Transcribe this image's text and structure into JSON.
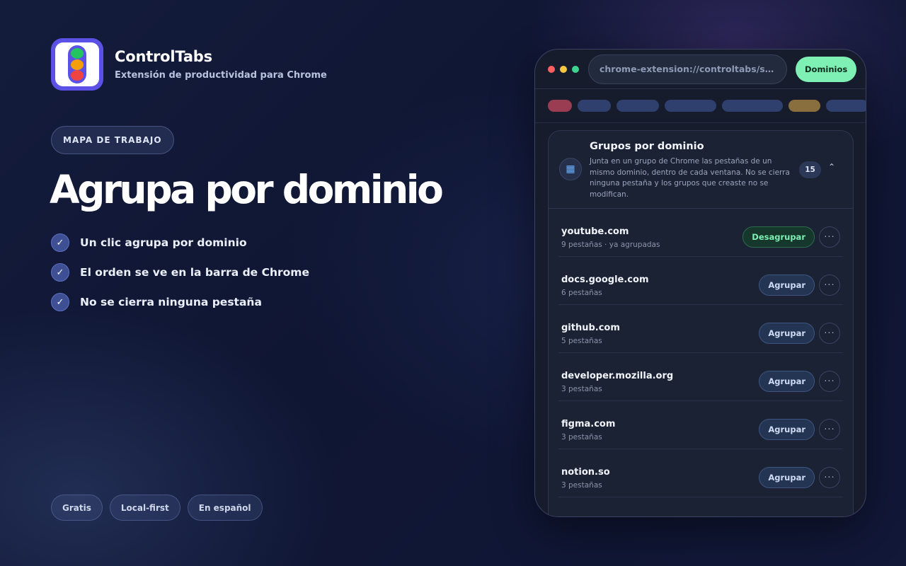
{
  "brand": {
    "name": "ControlTabs",
    "tagline": "Extensión de productividad para Chrome"
  },
  "eyebrow": "MAPA DE TRABAJO",
  "headline": "Agrupa por dominio",
  "features": [
    "Un clic agrupa por dominio",
    "El orden se ve en la barra de Chrome",
    "No se cierra ninguna pestaña"
  ],
  "check_glyph": "✓",
  "badges": [
    "Gratis",
    "Local-first",
    "En español"
  ],
  "browser": {
    "url": "chrome-extension://controltabs/sidepanel",
    "action_label": "Dominios"
  },
  "tab_colors": [
    "#9b3d52",
    "#2f3f6e",
    "#2f3f6e",
    "#2f3f6e",
    "#2f3f6e",
    "#8a6f3e",
    "#2f3f6e"
  ],
  "panel": {
    "title": "Grupos por dominio",
    "description": "Junta en un grupo de Chrome las pestañas de un mismo dominio, dentro de cada ventana. No se cierra ninguna pestaña y los grupos que creaste no se modifican.",
    "count": "15",
    "icon": "grid-icon",
    "caret": "chevron-up-icon"
  },
  "rows": [
    {
      "domain": "youtube.com",
      "meta": "9 pestañas · ya agrupadas",
      "action": "Desagrupar",
      "state": "grouped"
    },
    {
      "domain": "docs.google.com",
      "meta": "6 pestañas",
      "action": "Agrupar",
      "state": "ungrouped"
    },
    {
      "domain": "github.com",
      "meta": "5 pestañas",
      "action": "Agrupar",
      "state": "ungrouped"
    },
    {
      "domain": "developer.mozilla.org",
      "meta": "3 pestañas",
      "action": "Agrupar",
      "state": "ungrouped"
    },
    {
      "domain": "figma.com",
      "meta": "3 pestañas",
      "action": "Agrupar",
      "state": "ungrouped"
    },
    {
      "domain": "notion.so",
      "meta": "3 pestañas",
      "action": "Agrupar",
      "state": "ungrouped"
    }
  ],
  "more_glyph": "···",
  "colors": {
    "accent": "#5b51e6",
    "success": "#7ef0b4",
    "background": "#0f1633"
  }
}
